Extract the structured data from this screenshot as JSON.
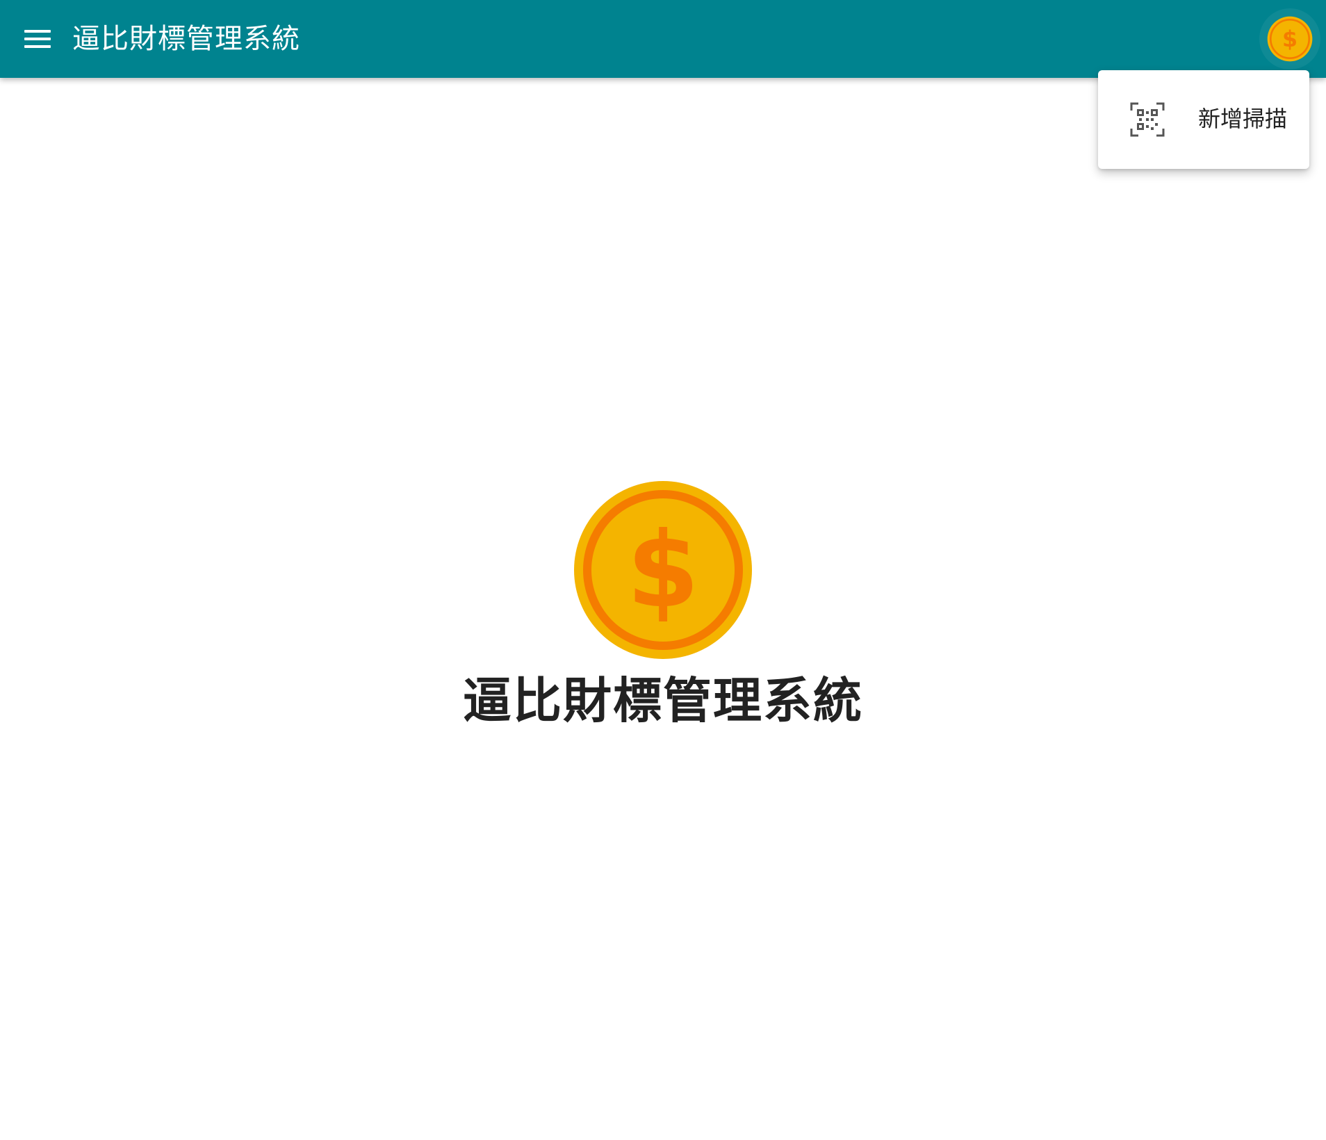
{
  "app_bar": {
    "title": "逼比財標管理系統",
    "background_color": "#00838f",
    "menu_icon": "hamburger-menu-icon",
    "avatar_icon": "coin-dollar-icon"
  },
  "popup_menu": {
    "items": [
      {
        "label": "新增掃描",
        "icon": "qr-code-scan-icon"
      }
    ]
  },
  "hero": {
    "logo_icon": "coin-dollar-icon",
    "logo_symbol": "$",
    "title": "逼比財標管理系統"
  },
  "colors": {
    "coin_fill": "#f4b400",
    "coin_ring": "#f57c00",
    "text_dark": "#222222"
  }
}
